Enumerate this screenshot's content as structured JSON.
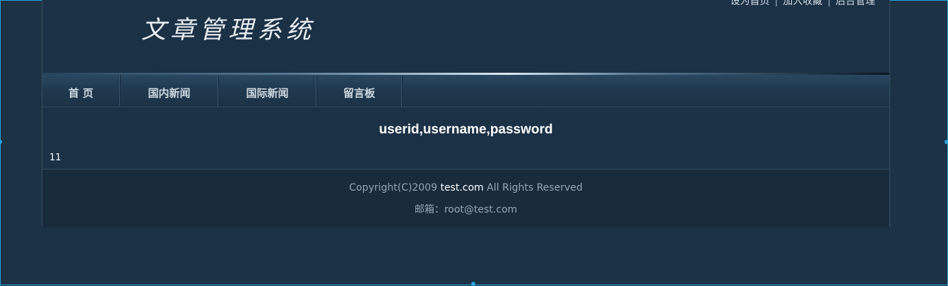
{
  "header": {
    "logo_text": "文章管理系统",
    "links": [
      {
        "label": "设为首页"
      },
      {
        "label": "加入收藏"
      },
      {
        "label": "后台管理"
      }
    ],
    "separator": "|"
  },
  "nav": {
    "items": [
      {
        "label": "首 页"
      },
      {
        "label": "国内新闻"
      },
      {
        "label": "国际新闻"
      },
      {
        "label": "留言板"
      }
    ]
  },
  "main": {
    "title": "userid,username,password",
    "value": "11"
  },
  "footer": {
    "copyright_prefix": "Copyright(C)2009",
    "brand": "test.com",
    "copyright_suffix": "All Rights Reserved",
    "email_line": "邮箱：root@test.com"
  },
  "colors": {
    "page_bg": "#1c3245",
    "selection": "#2aa3e0"
  }
}
